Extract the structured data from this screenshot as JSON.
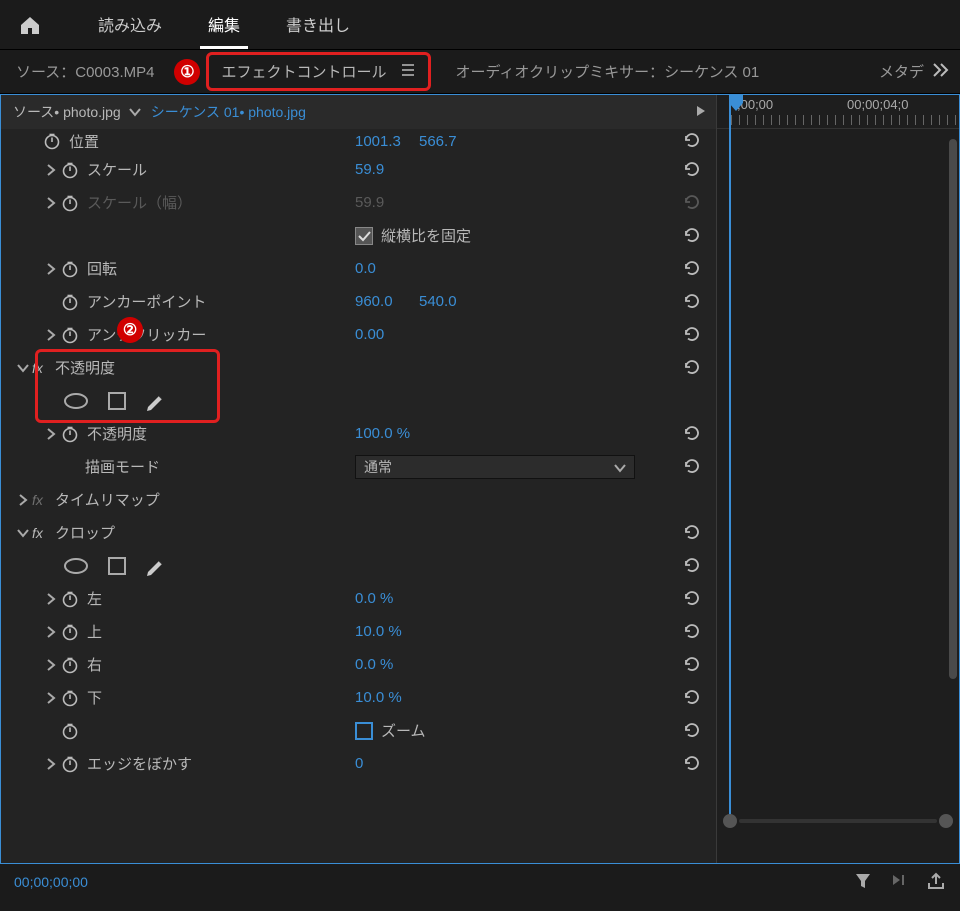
{
  "topbar": {
    "tabs": {
      "import": "読み込み",
      "edit": "編集",
      "export": "書き出し"
    }
  },
  "panels": {
    "source": "ソース：C0003.MP4",
    "effect_controls": "エフェクトコントロール",
    "audio_mixer": "オーディオクリップミキサー：シーケンス 01",
    "metadata": "メタデ"
  },
  "badges": {
    "one": "①",
    "two": "②"
  },
  "source_row": {
    "clip": "ソース• photo.jpg",
    "seq": "シーケンス 01• photo.jpg"
  },
  "timeline": {
    "t0": ";00;00",
    "t1": "00;00;04;0"
  },
  "props": {
    "position": {
      "label": "位置",
      "x": "1001.3",
      "y": "566.7"
    },
    "scale": {
      "label": "スケール",
      "val": "59.9"
    },
    "scale_w": {
      "label": "スケール（幅）",
      "val": "59.9"
    },
    "lock_aspect": "縦横比を固定",
    "rotation": {
      "label": "回転",
      "val": "0.0"
    },
    "anchor": {
      "label": "アンカーポイント",
      "x": "960.0",
      "y": "540.0"
    },
    "antiflicker": {
      "label": "アンチフリッカー",
      "val": "0.00"
    },
    "opacity_section": "不透明度",
    "opacity": {
      "label": "不透明度",
      "val": "100.0 %"
    },
    "blend": {
      "label": "描画モード",
      "val": "通常"
    },
    "time_remap": "タイムリマップ",
    "crop_section": "クロップ",
    "crop": {
      "left": {
        "label": "左",
        "val": "0.0 %"
      },
      "top": {
        "label": "上",
        "val": "10.0 %"
      },
      "right": {
        "label": "右",
        "val": "0.0 %"
      },
      "bottom": {
        "label": "下",
        "val": "10.0 %"
      },
      "zoom": "ズーム",
      "edge": {
        "label": "エッジをぼかす",
        "val": "0"
      }
    }
  },
  "bottom": {
    "timecode": "00;00;00;00"
  }
}
